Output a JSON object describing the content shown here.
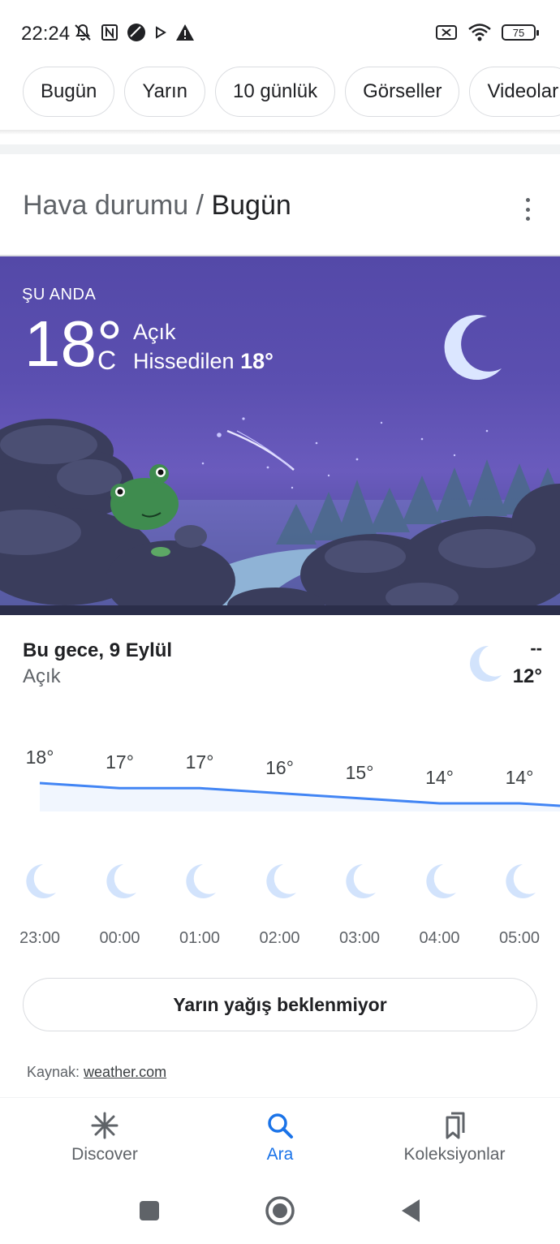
{
  "status_bar": {
    "time": "22:24",
    "battery": "75",
    "icons": [
      "mute-icon",
      "nfc-icon",
      "app-icon",
      "play-icon",
      "alert-icon",
      "sim-off-icon",
      "wifi-icon",
      "battery-icon"
    ]
  },
  "chips": [
    "Bugün",
    "Yarın",
    "10 günlük",
    "Görseller",
    "Videolar"
  ],
  "header": {
    "title_prefix": "Hava durumu / ",
    "title_strong": "Bugün"
  },
  "now": {
    "label": "ŞU ANDA",
    "temp": "18°",
    "unit": "C",
    "condition": "Açık",
    "feels_prefix": "Hissedilen ",
    "feels_value": "18°"
  },
  "tonight": {
    "title": "Bu gece, 9 Eylül",
    "condition": "Açık",
    "high": "--",
    "low": "12°"
  },
  "chart_data": {
    "type": "line",
    "x": [
      "23:00",
      "00:00",
      "01:00",
      "02:00",
      "03:00",
      "04:00",
      "05:00"
    ],
    "series": [
      {
        "values": [
          18,
          17,
          17,
          16,
          15,
          14,
          14
        ]
      }
    ],
    "labels": [
      "18°",
      "17°",
      "17°",
      "16°",
      "15°",
      "14°",
      "14°"
    ],
    "icons": [
      "moon-icon",
      "moon-icon",
      "moon-icon",
      "moon-icon",
      "moon-icon",
      "moon-icon",
      "moon-icon"
    ],
    "line_color": "#4285f4"
  },
  "rain_button": "Yarın yağış beklenmiyor",
  "source": {
    "prefix": "Kaynak: ",
    "link": "weather.com"
  },
  "bottom_nav": [
    {
      "label": "Discover",
      "icon": "asterisk-icon",
      "active": false
    },
    {
      "label": "Ara",
      "icon": "search-icon",
      "active": true
    },
    {
      "label": "Koleksiyonlar",
      "icon": "bookmarks-icon",
      "active": false
    }
  ],
  "colors": {
    "accent": "#1a73e8",
    "hero_sky": "#5449a8",
    "moon": "#dbe6ff"
  }
}
